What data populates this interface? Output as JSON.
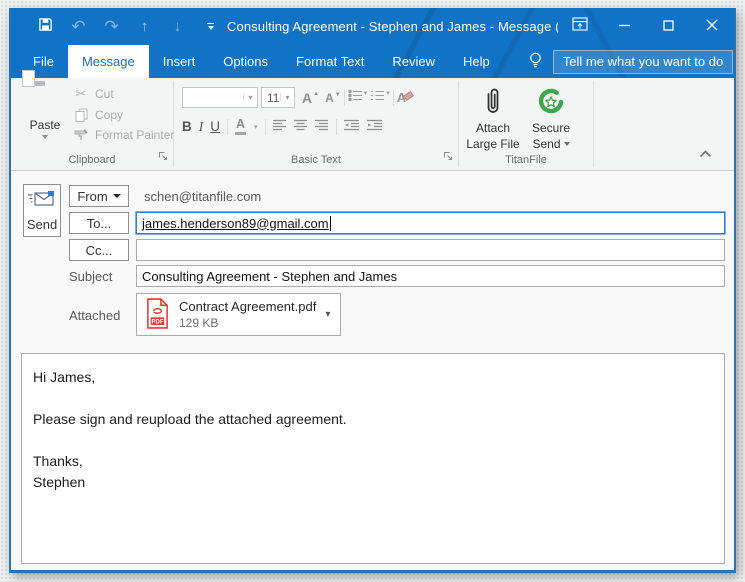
{
  "window": {
    "title": "Consulting Agreement - Stephen and James  -  Message (H..."
  },
  "tabs": {
    "items": [
      {
        "label": "File"
      },
      {
        "label": "Message"
      },
      {
        "label": "Insert"
      },
      {
        "label": "Options"
      },
      {
        "label": "Format Text"
      },
      {
        "label": "Review"
      },
      {
        "label": "Help"
      }
    ],
    "active": "Message",
    "tellme": "Tell me what you want to do"
  },
  "ribbon": {
    "clipboard": {
      "paste": "Paste",
      "cut": "Cut",
      "copy": "Copy",
      "format_painter": "Format Painter",
      "group_label": "Clipboard"
    },
    "basic_text": {
      "font_name": "",
      "font_size": "11",
      "group_label": "Basic Text"
    },
    "titanfile": {
      "attach_line1": "Attach",
      "attach_line2": "Large File",
      "secure_line1": "Secure",
      "secure_line2": "Send",
      "group_label": "TitanFile"
    }
  },
  "envelope": {
    "send_label": "Send",
    "from_label": "From",
    "from_value": "schen@titanfile.com",
    "to_label": "To...",
    "to_value": "james.henderson89@gmail.com",
    "cc_label": "Cc...",
    "cc_value": "",
    "subject_label": "Subject",
    "subject_value": "Consulting Agreement - Stephen and James",
    "attached_label": "Attached",
    "attachment": {
      "name": "Contract Agreement.pdf",
      "size": "129 KB",
      "type": "PDF"
    }
  },
  "body": {
    "lines": [
      "Hi James,",
      "Please sign and reupload the attached agreement.",
      "Thanks,",
      "Stephen"
    ]
  },
  "colors": {
    "titlebar_blue": "#1173c5",
    "active_tab_text": "#1a6dbf",
    "focus_field_border": "#2b7cd3",
    "titanfile_green": "#3fa64c",
    "pdf_red": "#e13b32"
  }
}
